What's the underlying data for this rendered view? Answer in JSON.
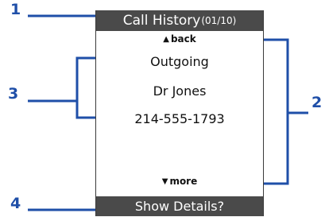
{
  "callouts": {
    "one": "1",
    "two": "2",
    "three": "3",
    "four": "4"
  },
  "screen": {
    "title": "Call History",
    "title_counter": "(01/10)",
    "nav_up_label": "back",
    "nav_up_icon": "up-triangle-icon",
    "nav_down_label": "more",
    "nav_down_icon": "down-triangle-icon",
    "call_type": "Outgoing",
    "contact_name": "Dr Jones",
    "phone_number": "214-555-1793",
    "softkey_label": "Show Details?"
  },
  "colors": {
    "callout": "#1f4fa8",
    "bar_background": "#4a4a4a",
    "bar_text": "#ffffff"
  }
}
